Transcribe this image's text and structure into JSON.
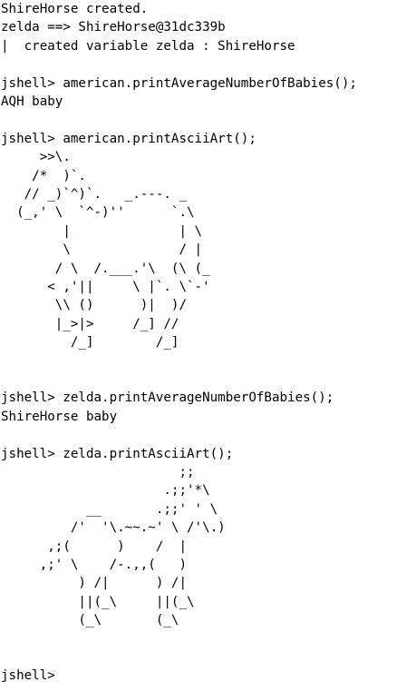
{
  "terminal": {
    "preamble": [
      "ShireHorse created.",
      "zelda ==> ShireHorse@31dc339b",
      "|  created variable zelda : ShireHorse",
      ""
    ],
    "cmd1": "jshell> american.printAverageNumberOfBabies();",
    "out1": "AQH baby",
    "blank1": "",
    "cmd2": "jshell> american.printAsciiArt();",
    "art1": "     >>\\.\n    /*  )`.\n   // _)`^)`.   _.---. _\n  (_,' \\  `^-)''      `.\\\n        |              | \\\n        \\              / |\n       / \\  /.___.'\\  (\\ (_\n      < ,'||     \\ |`. \\`-'\n       \\\\ ()      )|  )/\n       |_>|>     /_] //\n         /_]        /_]",
    "blank2": "",
    "blank3": "",
    "cmd3": "jshell> zelda.printAverageNumberOfBabies();",
    "out3": "ShireHorse baby",
    "blank4": "",
    "cmd4": "jshell> zelda.printAsciiArt();",
    "art2": "                       ;;\n                     .;;'*\\\n           __       .;;' ' \\\n         /'  '\\.~~.~' \\ /'\\.)\n      ,;(      )    /  |\n     ,;' \\    /-.,,(   )\n          ) /|      ) /|\n          ||(_\\     ||(_\\\n          (_\\       (_\\",
    "blank5": "",
    "blank6": "",
    "prompt": "jshell>"
  }
}
